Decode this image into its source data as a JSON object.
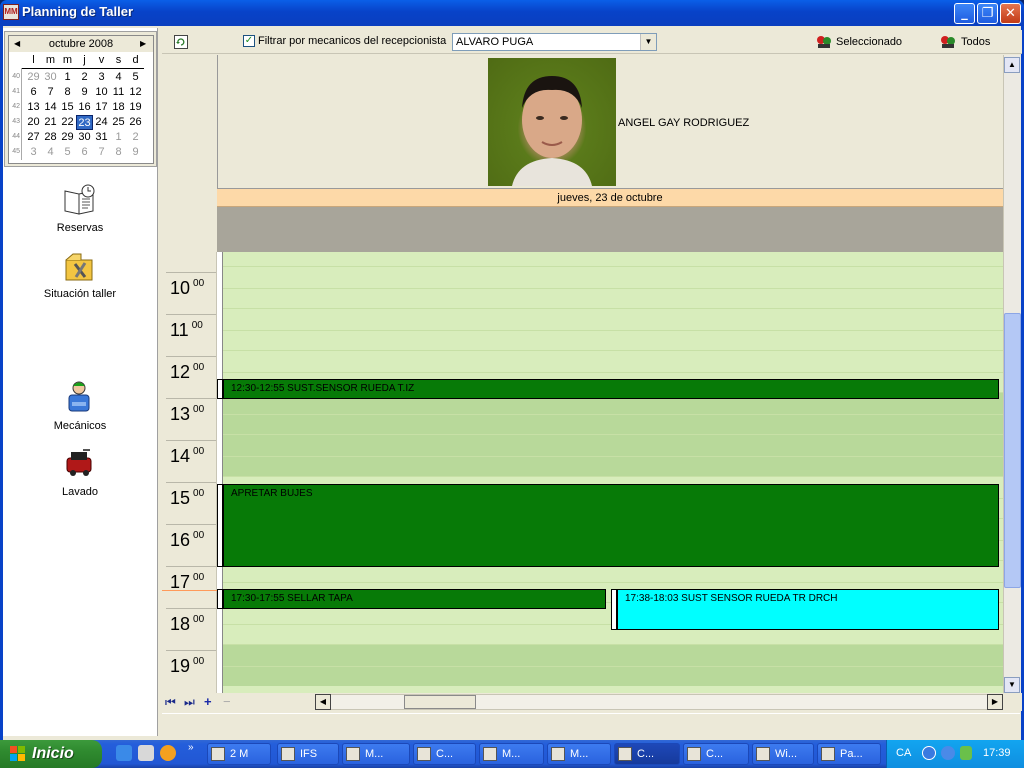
{
  "window": {
    "title": "Planning de Taller",
    "app_icon": "MM",
    "minimize": "_",
    "maximize": "❐",
    "close": "✕"
  },
  "calendar": {
    "month_label": "octubre 2008",
    "prev": "◀",
    "next": "▶",
    "days_of_week": [
      "l",
      "m",
      "m",
      "j",
      "v",
      "s",
      "d"
    ],
    "weeks": [
      {
        "wk": "40",
        "days": [
          [
            "29",
            "gray"
          ],
          [
            "30",
            "gray"
          ],
          [
            "1",
            ""
          ],
          [
            "2",
            ""
          ],
          [
            "3",
            ""
          ],
          [
            "4",
            ""
          ],
          [
            "5",
            ""
          ]
        ]
      },
      {
        "wk": "41",
        "days": [
          [
            "6",
            ""
          ],
          [
            "7",
            ""
          ],
          [
            "8",
            ""
          ],
          [
            "9",
            ""
          ],
          [
            "10",
            ""
          ],
          [
            "11",
            ""
          ],
          [
            "12",
            ""
          ]
        ]
      },
      {
        "wk": "42",
        "days": [
          [
            "13",
            ""
          ],
          [
            "14",
            ""
          ],
          [
            "15",
            ""
          ],
          [
            "16",
            ""
          ],
          [
            "17",
            ""
          ],
          [
            "18",
            ""
          ],
          [
            "19",
            ""
          ]
        ]
      },
      {
        "wk": "43",
        "days": [
          [
            "20",
            ""
          ],
          [
            "21",
            ""
          ],
          [
            "22",
            ""
          ],
          [
            "23",
            "sel"
          ],
          [
            "24",
            ""
          ],
          [
            "25",
            ""
          ],
          [
            "26",
            ""
          ]
        ]
      },
      {
        "wk": "44",
        "days": [
          [
            "27",
            ""
          ],
          [
            "28",
            ""
          ],
          [
            "29",
            ""
          ],
          [
            "30",
            ""
          ],
          [
            "31",
            ""
          ],
          [
            "1",
            "gray"
          ],
          [
            "2",
            "gray"
          ]
        ]
      },
      {
        "wk": "45",
        "days": [
          [
            "3",
            "gray"
          ],
          [
            "4",
            "gray"
          ],
          [
            "5",
            "gray"
          ],
          [
            "6",
            "gray"
          ],
          [
            "7",
            "gray"
          ],
          [
            "8",
            "gray"
          ],
          [
            "9",
            "gray"
          ]
        ]
      }
    ]
  },
  "nav": {
    "reservas": "Reservas",
    "situacion": "Situación taller",
    "mecanicos": "Mecánicos",
    "lavado": "Lavado"
  },
  "toolbar": {
    "refresh_icon": "refresh-icon",
    "filter_checked": "✓",
    "filter_label": "Filtrar por mecanicos del recepcionista",
    "receptionist": "ALVARO PUGA",
    "dropdown_arrow": "▼",
    "seleccionado": "Seleccionado",
    "todos": "Todos"
  },
  "mechanic": {
    "name": "ANGEL GAY RODRIGUEZ"
  },
  "date_label": "jueves, 23 de octubre",
  "hours": [
    {
      "h": "10",
      "m": "00"
    },
    {
      "h": "11",
      "m": "00"
    },
    {
      "h": "12",
      "m": "00"
    },
    {
      "h": "13",
      "m": "00"
    },
    {
      "h": "14",
      "m": "00"
    },
    {
      "h": "15",
      "m": "00"
    },
    {
      "h": "16",
      "m": "00"
    },
    {
      "h": "17",
      "m": "00"
    },
    {
      "h": "18",
      "m": "00"
    },
    {
      "h": "19",
      "m": "00"
    }
  ],
  "appointments": [
    {
      "label": "12:30-12:55 SUST.SENSOR RUEDA T.IZ",
      "color": "#077a07"
    },
    {
      "label": "APRETAR BUJES",
      "color": "#077a07"
    },
    {
      "label": "17:30-17:55 SELLAR TAPA",
      "color": "#077a07"
    },
    {
      "label": "17:38-18:03 SUST SENSOR RUEDA TR DRCH",
      "color": "#00ffff"
    }
  ],
  "scroll": {
    "first": "⏮",
    "last": "⏭",
    "add": "+",
    "remove": "−",
    "left": "◀",
    "right": "▶",
    "up": "▲",
    "down": "▼"
  },
  "taskbar": {
    "start": "Inicio",
    "expand": "»",
    "items": [
      "2 M",
      "IFS",
      "M...",
      "C...",
      "M...",
      "M...",
      "C...",
      "C...",
      "Wi...",
      "Pa..."
    ],
    "tray_lang": "CA",
    "clock": "17:39"
  }
}
